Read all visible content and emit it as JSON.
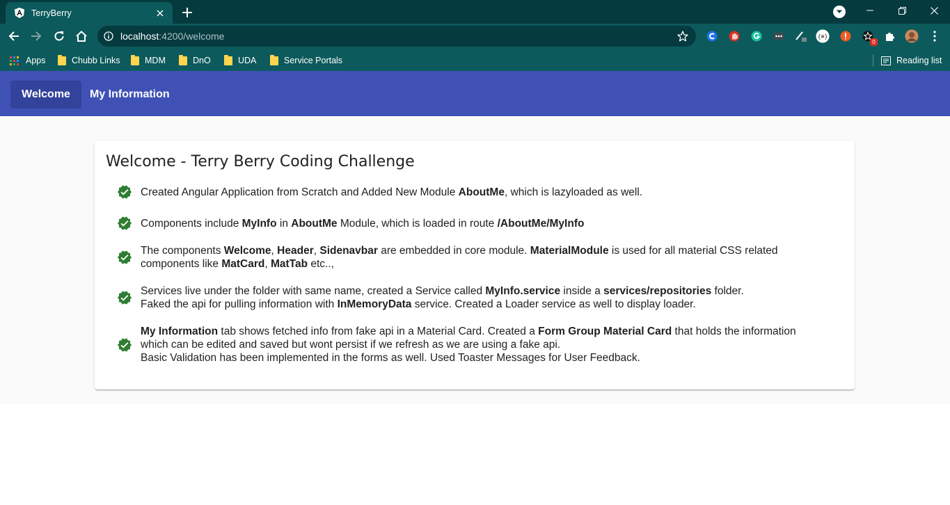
{
  "browser": {
    "tab": {
      "title": "TerryBerry"
    },
    "url": {
      "host": "localhost",
      "path": ":4200/welcome"
    },
    "bookmarks": [
      {
        "label": "Apps",
        "kind": "apps"
      },
      {
        "label": "Chubb Links",
        "kind": "folder"
      },
      {
        "label": "MDM",
        "kind": "folder"
      },
      {
        "label": "DnO",
        "kind": "folder"
      },
      {
        "label": "UDA",
        "kind": "folder"
      },
      {
        "label": "Service Portals",
        "kind": "folder"
      }
    ],
    "reading_list": "Reading list",
    "extension_badge": "0",
    "colors": {
      "frame": "#053a3f",
      "toolbar": "#0d5a5c"
    }
  },
  "app": {
    "nav": [
      {
        "label": "Welcome",
        "active": true
      },
      {
        "label": "My Information",
        "active": false
      }
    ],
    "card": {
      "title": "Welcome - Terry Berry Coding Challenge",
      "items": [
        [
          {
            "t": "Created Angular Application from Scratch and Added New Module "
          },
          {
            "t": "AboutMe",
            "b": true
          },
          {
            "t": ", which is lazyloaded as well."
          }
        ],
        [
          {
            "t": "Components include "
          },
          {
            "t": "MyInfo",
            "b": true
          },
          {
            "t": " in "
          },
          {
            "t": "AboutMe",
            "b": true
          },
          {
            "t": " Module, which is loaded in route "
          },
          {
            "t": "/AboutMe/MyInfo",
            "b": true
          }
        ],
        [
          {
            "t": "The components "
          },
          {
            "t": "Welcome",
            "b": true
          },
          {
            "t": ", "
          },
          {
            "t": "Header",
            "b": true
          },
          {
            "t": ", "
          },
          {
            "t": "Sidenavbar",
            "b": true
          },
          {
            "t": " are embedded in core module. "
          },
          {
            "t": "MaterialModule",
            "b": true
          },
          {
            "t": " is used for all material CSS related"
          },
          {
            "br": true
          },
          {
            "t": "components like "
          },
          {
            "t": "MatCard",
            "b": true
          },
          {
            "t": ", "
          },
          {
            "t": "MatTab",
            "b": true
          },
          {
            "t": " etc..,"
          }
        ],
        [
          {
            "t": "Services live under the folder with same name, created a Service called "
          },
          {
            "t": "MyInfo.service",
            "b": true
          },
          {
            "t": " inside a "
          },
          {
            "t": "services/repositories",
            "b": true
          },
          {
            "t": " folder."
          },
          {
            "br": true
          },
          {
            "t": "Faked the api for pulling information with "
          },
          {
            "t": "InMemoryData",
            "b": true
          },
          {
            "t": " service. Created a Loader service as well to display loader."
          }
        ],
        [
          {
            "t": "My Information",
            "b": true
          },
          {
            "t": " tab shows fetched info from fake api in a Material Card. Created a "
          },
          {
            "t": "Form Group Material Card",
            "b": true
          },
          {
            "t": " that holds the information"
          },
          {
            "br": true
          },
          {
            "t": "which can be edited and saved but wont persist if we refresh as we are using a fake api."
          },
          {
            "br": true
          },
          {
            "t": "Basic Validation has been implemented in the forms as well. Used Toaster Messages for User Feedback."
          }
        ]
      ]
    },
    "colors": {
      "primary": "#3f51b5",
      "active_tab": "#33429a",
      "check": "#2e7d32"
    }
  }
}
